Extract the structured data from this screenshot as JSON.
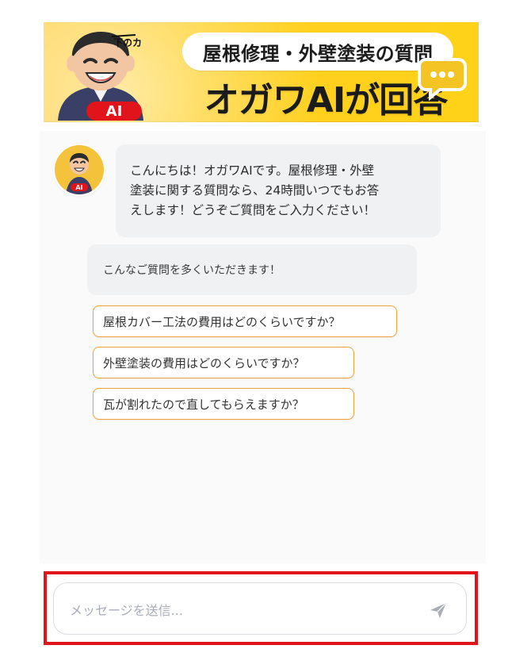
{
  "banner": {
    "top_text": "屋根修理・外壁塗装の質問",
    "main_text": "オガワAIが回答",
    "badge_text": "AI",
    "avatar_caption": "下のカ",
    "avatar_icon": "smiling-man-illustration",
    "chat_icon": "speech-bubble-icon",
    "accent_color": "#f4c324",
    "badge_color": "#e0141a"
  },
  "chat": {
    "bot_avatar_badge": "AI",
    "greeting": "こんにちは！オガワAIです。屋根修理・外壁\n塗装に関する質問なら、24時間いつでもお答\nえします！どうぞご質問をご入力ください！",
    "suggest_heading": "こんなご質問を多くいただきます！",
    "suggestions": [
      "屋根カバー工法の費用はどのくらいですか？",
      "外壁塗装の費用はどのくらいですか？",
      "瓦が割れたので直してもらえますか？"
    ],
    "suggestion_border_color": "#f0a33a"
  },
  "input": {
    "placeholder": "メッセージを送信...",
    "value": "",
    "send_icon": "paper-plane-icon",
    "highlight_color": "#e0141a"
  }
}
